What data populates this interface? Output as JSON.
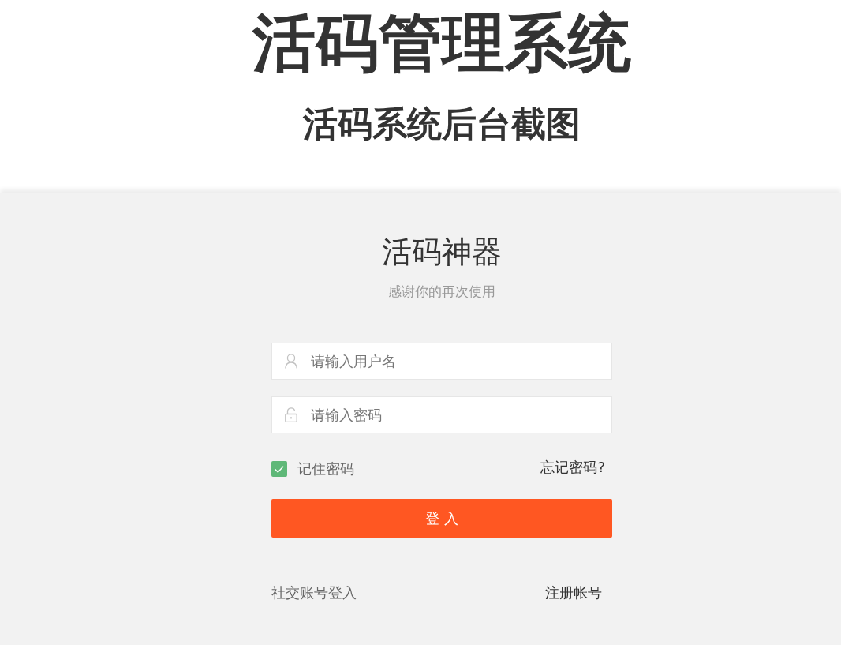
{
  "header": {
    "title": "活码管理系统",
    "subtitle": "活码系统后台截图"
  },
  "login": {
    "title": "活码神器",
    "subtitle": "感谢你的再次使用",
    "fields": [
      {
        "kind": "user",
        "placeholder": "请输入用户名"
      },
      {
        "kind": "password",
        "placeholder": "请输入密码"
      }
    ],
    "remember": {
      "label": "记住密码",
      "checked": true
    },
    "forgot_link": "忘记密码?",
    "submit": "登 入",
    "links": [
      "社交账号登入",
      "注册帐号"
    ]
  }
}
